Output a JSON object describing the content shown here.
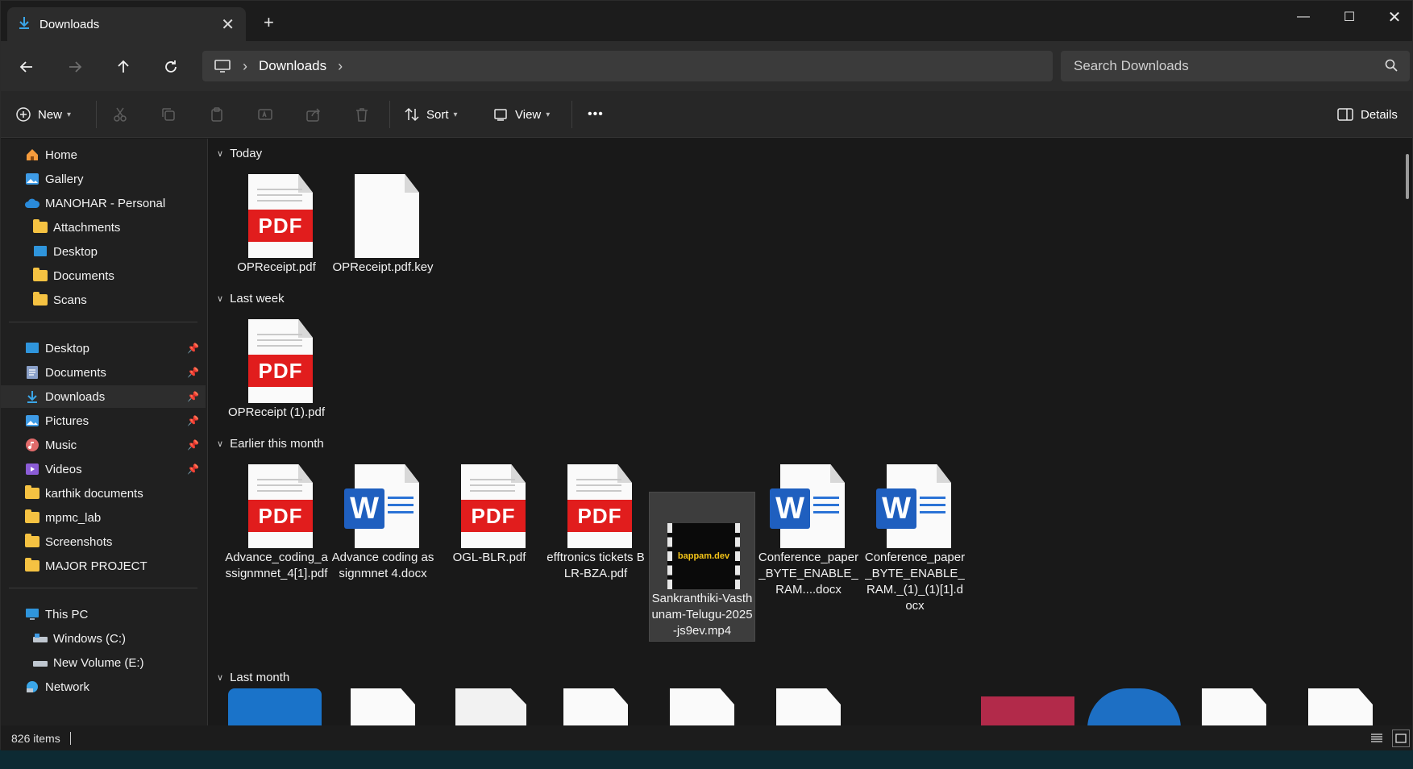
{
  "tab": {
    "title": "Downloads",
    "close": "✕",
    "new": "+"
  },
  "window_controls": {
    "minimize": "—",
    "maximize": "☐",
    "close": "✕"
  },
  "address": {
    "crumbs": [
      "Downloads"
    ]
  },
  "search": {
    "placeholder": "Search Downloads"
  },
  "commands": {
    "new": "New",
    "sort": "Sort",
    "view": "View",
    "more": "•••",
    "details": "Details"
  },
  "sidebar": {
    "top": [
      {
        "label": "Home"
      },
      {
        "label": "Gallery"
      },
      {
        "label": "MANOHAR - Personal"
      },
      {
        "label": "Attachments"
      },
      {
        "label": "Desktop"
      },
      {
        "label": "Documents"
      },
      {
        "label": "Scans"
      }
    ],
    "quick": [
      {
        "label": "Desktop"
      },
      {
        "label": "Documents"
      },
      {
        "label": "Downloads"
      },
      {
        "label": "Pictures"
      },
      {
        "label": "Music"
      },
      {
        "label": "Videos"
      },
      {
        "label": "karthik documents"
      },
      {
        "label": "mpmc_lab"
      },
      {
        "label": "Screenshots"
      },
      {
        "label": "MAJOR PROJECT"
      }
    ],
    "pc": [
      {
        "label": "This PC"
      },
      {
        "label": "Windows (C:)"
      },
      {
        "label": "New Volume (E:)"
      },
      {
        "label": "Network"
      }
    ]
  },
  "groups": [
    {
      "title": "Today",
      "files": [
        {
          "name": "OPReceipt.pdf",
          "kind": "pdf"
        },
        {
          "name": "OPReceipt.pdf.key",
          "kind": "blank"
        }
      ]
    },
    {
      "title": "Last week",
      "files": [
        {
          "name": "OPReceipt (1).pdf",
          "kind": "pdf"
        }
      ]
    },
    {
      "title": "Earlier this month",
      "files": [
        {
          "name": "Advance_coding_assignmnet_4[1].pdf",
          "kind": "pdf"
        },
        {
          "name": "Advance coding assignmnet 4.docx",
          "kind": "word"
        },
        {
          "name": "OGL-BLR.pdf",
          "kind": "pdf"
        },
        {
          "name": "efftronics tickets BLR-BZA.pdf",
          "kind": "pdf"
        },
        {
          "name": "Sankranthiki-Vasthunam-Telugu-2025-js9ev.mp4",
          "kind": "video",
          "thumb_text": "bappam.dev"
        },
        {
          "name": "Conference_paper_BYTE_ENABLE_RAM....docx",
          "kind": "word"
        },
        {
          "name": "Conference_paper_BYTE_ENABLE_RAM._(1)_(1)[1].docx",
          "kind": "word"
        }
      ]
    },
    {
      "title": "Last month",
      "files": []
    }
  ],
  "status": {
    "item_count": "826 items"
  },
  "colors": {
    "pdf_red": "#e11d1d",
    "word_blue": "#1f5fbf",
    "folder_yellow": "#f5c242",
    "selection": "#3d3d3d"
  }
}
